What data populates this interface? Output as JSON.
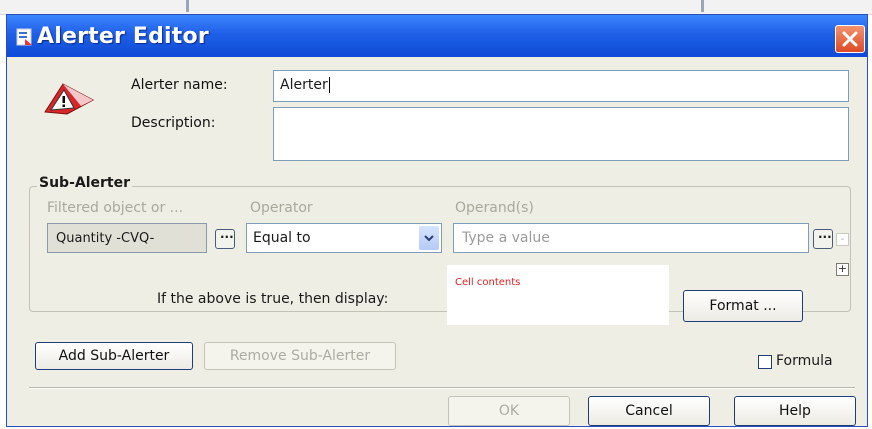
{
  "window": {
    "title": "Alerter Editor"
  },
  "icons": {
    "title": "alerter-editor-icon",
    "warning": "warning-icon",
    "close": "close-icon",
    "dropdown": "chevron-down-icon"
  },
  "colors": {
    "titlebar": "#1f5fe7",
    "close_button": "#dc4b25",
    "display_text": "#dd2222"
  },
  "form": {
    "name_label": "Alerter name:",
    "name_value": "Alerter",
    "description_label": "Description:",
    "description_value": ""
  },
  "sub_alerter": {
    "legend": "Sub-Alerter",
    "columns": {
      "filter": "Filtered object or ...",
      "operator": "Operator",
      "operands": "Operand(s)"
    },
    "filtered_object": "Quantity -CVQ-",
    "ellipsis": "...",
    "operator_value": "Equal to",
    "operand_placeholder": "Type a value",
    "remove_symbol": "-",
    "add_symbol": "+",
    "display_label": "If the above is true, then display:",
    "display_value": "Cell contents",
    "format_button": "Format ..."
  },
  "actions": {
    "add_sub_alerter": "Add Sub-Alerter",
    "remove_sub_alerter": "Remove Sub-Alerter",
    "formula_label": "Formula",
    "formula_checked": false
  },
  "footer": {
    "ok": "OK",
    "cancel": "Cancel",
    "help": "Help"
  }
}
